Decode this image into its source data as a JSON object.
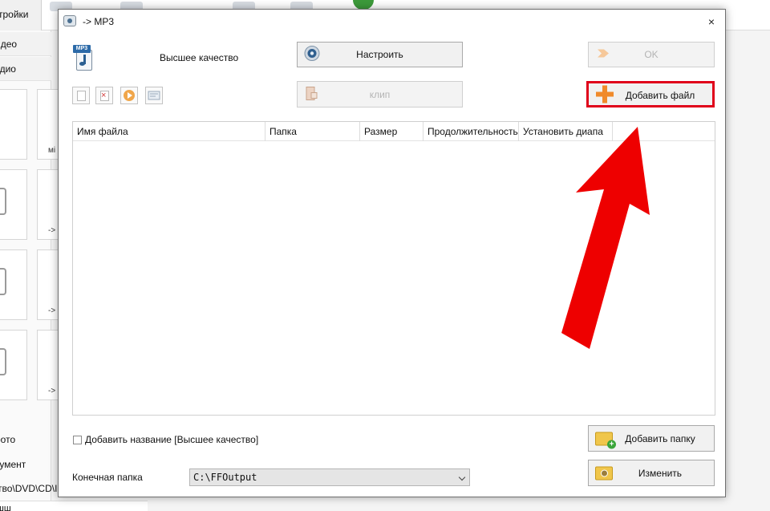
{
  "background_app": {
    "settings_tab": "стройки",
    "categories": [
      "идео",
      "удио"
    ],
    "tile_labels": [
      "мі",
      "->",
      "->",
      "->"
    ],
    "bottom_items": [
      "рото",
      "кумент"
    ],
    "bottom_path": "тво\\DVD\\CD\\I",
    "last_item": "шш"
  },
  "dialog": {
    "title": "-> MP3",
    "close_symbol": "×",
    "quality": "Высшее качество",
    "buttons": {
      "configure": "Настроить",
      "ok": "OK",
      "clip": "клип",
      "add_file": "Добавить файл",
      "add_folder": "Добавить папку",
      "change": "Изменить"
    },
    "table": {
      "columns": [
        "Имя файла",
        "Папка",
        "Размер",
        "Продолжительность",
        "Установить диапа"
      ],
      "rows": []
    },
    "add_name_checkbox": {
      "label": "Добавить название [Высшее качество]",
      "checked": false
    },
    "output_folder": {
      "label": "Конечная папка",
      "value": "C:\\FFOutput"
    }
  },
  "annotation": {
    "highlight_color": "#e0001a",
    "arrow_color": "#ee0000"
  }
}
